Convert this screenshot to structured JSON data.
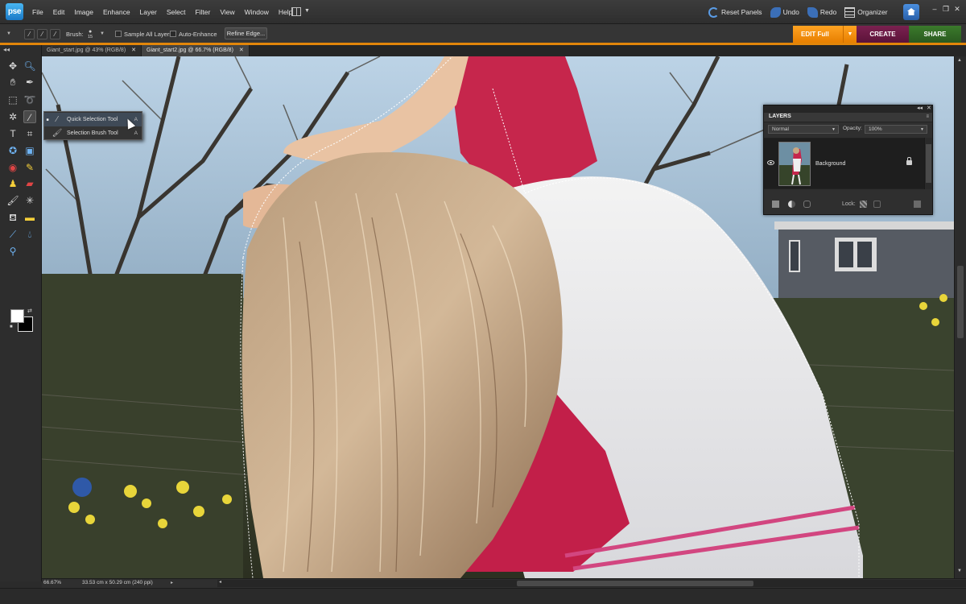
{
  "app": {
    "logo": "pse"
  },
  "menus": [
    "File",
    "Edit",
    "Image",
    "Enhance",
    "Layer",
    "Select",
    "Filter",
    "View",
    "Window",
    "Help"
  ],
  "right_tools": {
    "reset_panels": "Reset Panels",
    "undo": "Undo",
    "redo": "Redo",
    "organizer": "Organizer"
  },
  "window_controls": {
    "minimize": "–",
    "restore": "❐",
    "close": "✕"
  },
  "options_bar": {
    "brush_label": "Brush:",
    "brush_size": "15",
    "sample_all_layers": "Sample All Layers",
    "auto_enhance": "Auto-Enhance",
    "refine_edge": "Refine Edge..."
  },
  "mode_tabs": {
    "edit": "EDIT Full",
    "create": "CREATE",
    "share": "SHARE"
  },
  "colors": {
    "edit_tab": "#f08c10",
    "create_tab": "#6a1a44",
    "share_tab": "#336d26",
    "accent_line": "#e2860a",
    "app_bg": "#2b2b2b"
  },
  "doc_tabs": [
    {
      "label": "Giant_start.jpg @ 43% (RGB/8)",
      "close": "✕"
    },
    {
      "label": "Giant_start2.jpg @ 66.7% (RGB/8)",
      "close": "✕"
    }
  ],
  "flyout": {
    "items": [
      {
        "label": "Quick Selection Tool",
        "key": "A"
      },
      {
        "label": "Selection Brush Tool",
        "key": "A"
      }
    ]
  },
  "layers_panel": {
    "title": "LAYERS",
    "blend_mode": "Normal",
    "opacity_label": "Opacity:",
    "opacity_value": "100%",
    "layer_name": "Background",
    "lock_label": "Lock:"
  },
  "status": {
    "zoom": "66.67%",
    "doc_info": "33.53 cm x 50.29 cm (240 ppi)"
  },
  "icons": [
    "move-icon",
    "zoom-icon",
    "hand-icon",
    "eyedropper-icon",
    "marquee-icon",
    "lasso-icon",
    "magic-wand-icon",
    "quick-selection-icon",
    "type-icon",
    "crop-icon",
    "cookie-cutter-icon",
    "recompose-icon",
    "red-eye-icon",
    "spot-healing-icon",
    "clone-stamp-icon",
    "eraser-icon",
    "brush-icon",
    "smart-brush-icon",
    "paint-bucket-icon",
    "gradient-icon",
    "pencil-icon",
    "blur-icon",
    "sponge-icon"
  ]
}
